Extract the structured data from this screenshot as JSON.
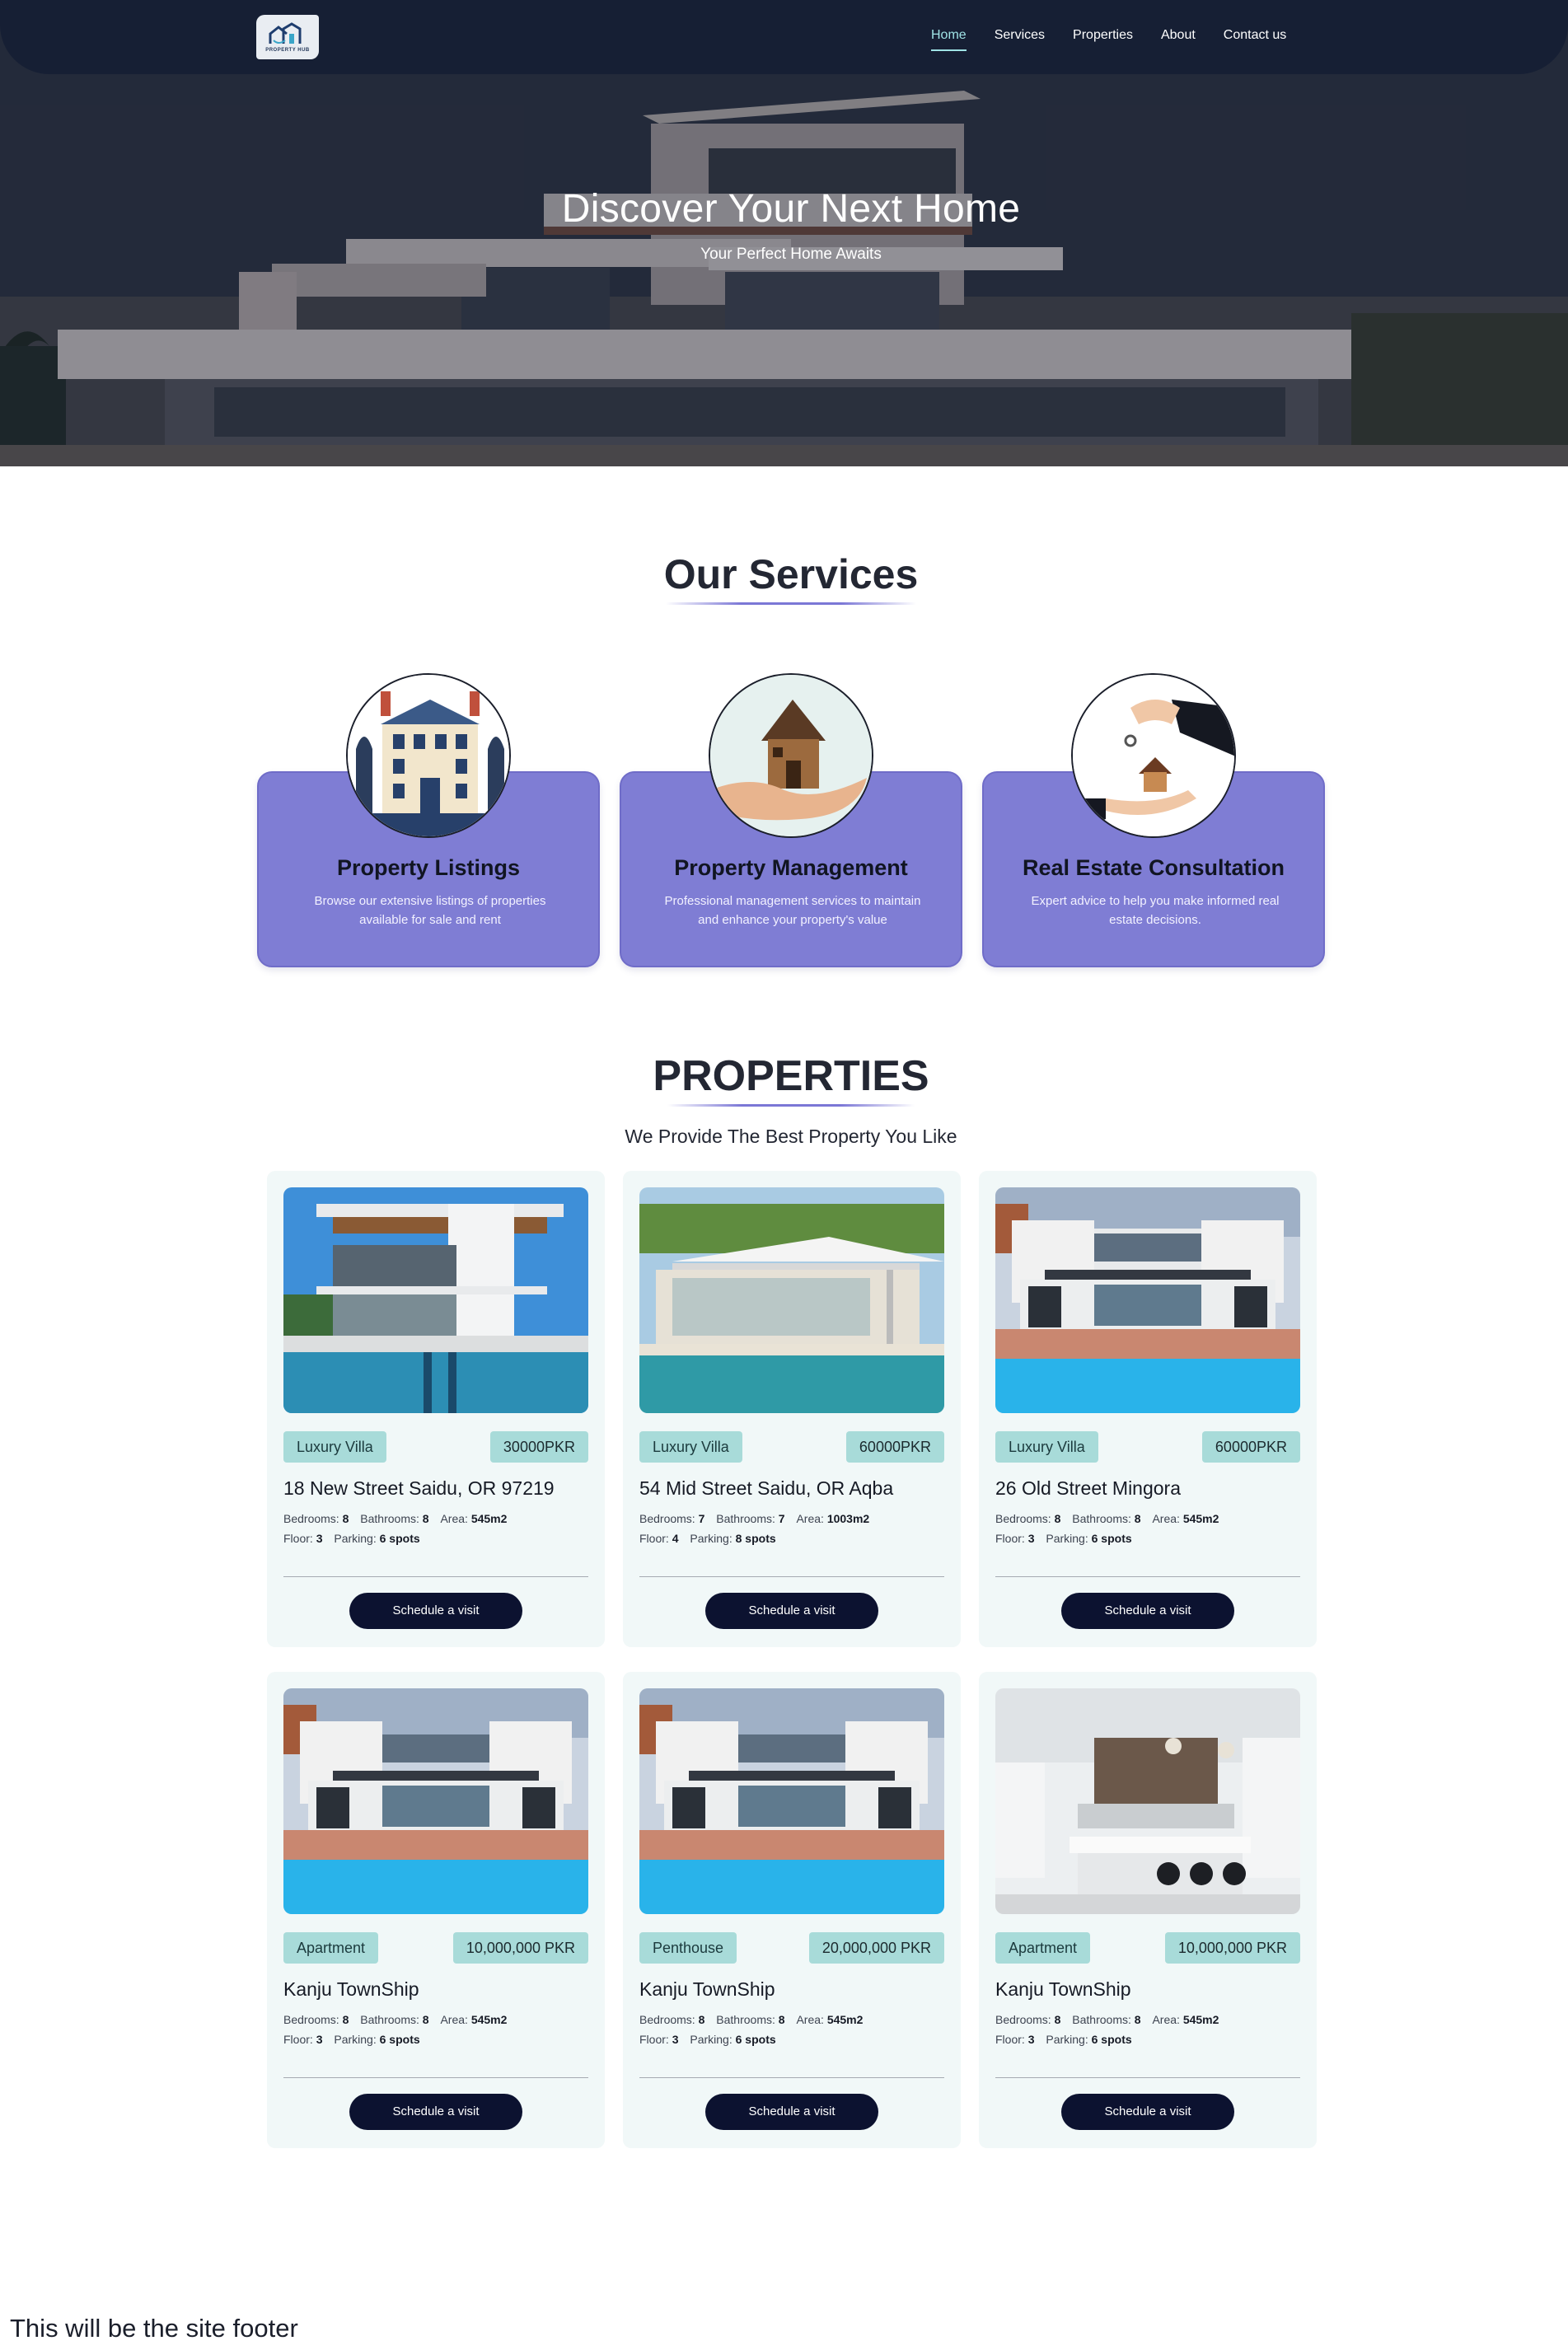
{
  "nav": {
    "logo_text": "PROPERTY HUB",
    "items": [
      {
        "label": "Home",
        "active": true
      },
      {
        "label": "Services",
        "active": false
      },
      {
        "label": "Properties",
        "active": false
      },
      {
        "label": "About",
        "active": false
      },
      {
        "label": "Contact us",
        "active": false
      }
    ]
  },
  "hero": {
    "title": "Discover Your Next Home",
    "subtitle": "Your Perfect Home Awaits"
  },
  "services": {
    "title": "Our Services",
    "items": [
      {
        "title": "Property Listings",
        "description": "Browse our extensive listings of properties available for sale and rent",
        "icon": "mansion-icon"
      },
      {
        "title": "Property Management",
        "description": "Professional management services to maintain and enhance your property's value",
        "icon": "house-in-hand-icon"
      },
      {
        "title": "Real Estate Consultation",
        "description": "Expert advice to help you make informed real estate decisions.",
        "icon": "key-handover-icon"
      }
    ]
  },
  "properties": {
    "title": "PROPERTIES",
    "subtitle": "We Provide The Best Property You Like",
    "labels": {
      "bedrooms": "Bedrooms:",
      "bathrooms": "Bathrooms:",
      "area": "Area:",
      "floor": "Floor:",
      "parking": "Parking:"
    },
    "button_label": "Schedule a visit",
    "items": [
      {
        "type": "Luxury Villa",
        "price": "30000PKR",
        "address": "18 New Street Saidu, OR 97219",
        "bedrooms": "8",
        "bathrooms": "8",
        "area": "545m2",
        "floor": "3",
        "parking": "6 spots",
        "image": "modern-villa-pool-photo"
      },
      {
        "type": "Luxury Villa",
        "price": "60000PKR",
        "address": "54 Mid Street Saidu, OR Aqba",
        "bedrooms": "7",
        "bathrooms": "7",
        "area": "1003m2",
        "floor": "4",
        "parking": "8 spots",
        "image": "glass-villa-pool-photo"
      },
      {
        "type": "Luxury Villa",
        "price": "60000PKR",
        "address": "26 Old Street Mingora",
        "bedrooms": "8",
        "bathrooms": "8",
        "area": "545m2",
        "floor": "3",
        "parking": "6 spots",
        "image": "villa-blue-pool-photo"
      },
      {
        "type": "Apartment",
        "price": "10,000,000 PKR",
        "address": "Kanju TownShip",
        "bedrooms": "8",
        "bathrooms": "8",
        "area": "545m2",
        "floor": "3",
        "parking": "6 spots",
        "image": "villa-blue-pool-photo"
      },
      {
        "type": "Penthouse",
        "price": "20,000,000 PKR",
        "address": "Kanju TownShip",
        "bedrooms": "8",
        "bathrooms": "8",
        "area": "545m2",
        "floor": "3",
        "parking": "6 spots",
        "image": "villa-blue-pool-photo"
      },
      {
        "type": "Apartment",
        "price": "10,000,000 PKR",
        "address": "Kanju TownShip",
        "bedrooms": "8",
        "bathrooms": "8",
        "area": "545m2",
        "floor": "3",
        "parking": "6 spots",
        "image": "white-kitchen-photo"
      }
    ]
  },
  "footer": {
    "text": "This will be the site footer"
  },
  "colors": {
    "nav_bg": "#161e34",
    "service_card": "#7f7dd4",
    "tag_bg": "#a8dbd9",
    "button_bg": "#0c1230",
    "card_bg": "#f1f8f8",
    "active_link": "#9fe3e6"
  }
}
